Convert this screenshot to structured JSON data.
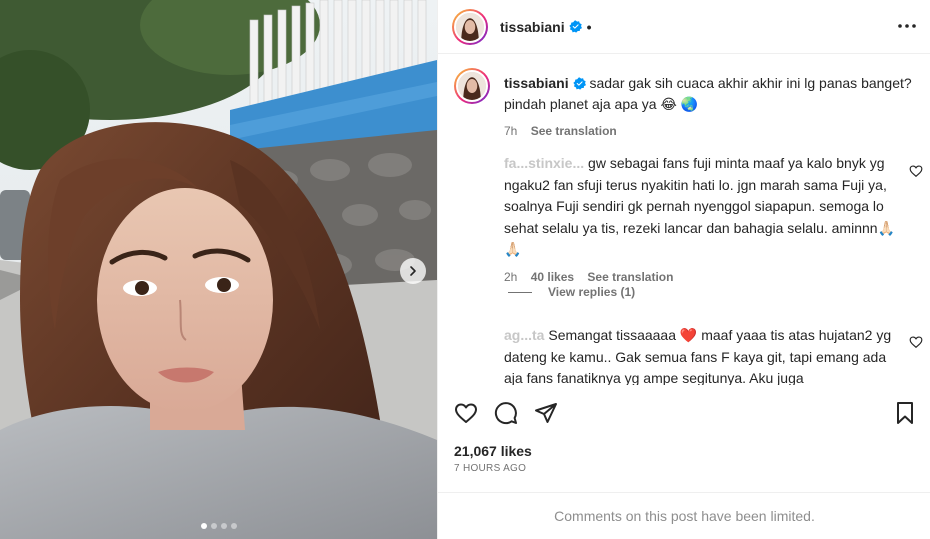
{
  "post": {
    "username": "tissabiani",
    "header_separator": "•",
    "caption": {
      "text": "sadar gak sih cuaca akhir akhir ini lg panas banget? pindah planet aja apa ya 😂 🌏",
      "time": "7h",
      "see_translation": "See translation"
    },
    "comments": [
      {
        "username": "fa...stinxie...",
        "text": "gw sebagai fans fuji minta maaf ya kalo bnyk yg ngaku2 fan sfuji terus nyakitin hati lo. jgn marah sama Fuji ya, soalnya Fuji sendiri gk pernah nyenggol siapapun. semoga lo sehat selalu ya tis, rezeki lancar dan bahagia selalu. aminnn🙏🏻🙏🏻",
        "time": "2h",
        "likes": "40 likes",
        "see_translation": "See translation",
        "view_replies": "View replies (1)"
      },
      {
        "username": "ag...ta",
        "text": "Semangat tissaaaaa ❤️ maaf yaaa tis atas hujatan2 yg dateng ke kamu.. Gak semua fans F kaya git, tapi emang ada aja fans fanatiknya yg ampe segitunya. Aku juga"
      }
    ],
    "likes_count": "21,067 likes",
    "posted_ago": "7 HOURS AGO",
    "comments_limited": "Comments on this post have been limited."
  },
  "carousel": {
    "total": 4,
    "active_index": 0
  },
  "colors": {
    "verified": "#0095f6",
    "text": "#262626",
    "muted": "#737373",
    "border": "#efefef"
  },
  "icons": [
    "verified-badge-icon",
    "more-options-icon",
    "heart-icon",
    "comment-icon",
    "share-icon",
    "save-icon",
    "chevron-right-icon"
  ]
}
